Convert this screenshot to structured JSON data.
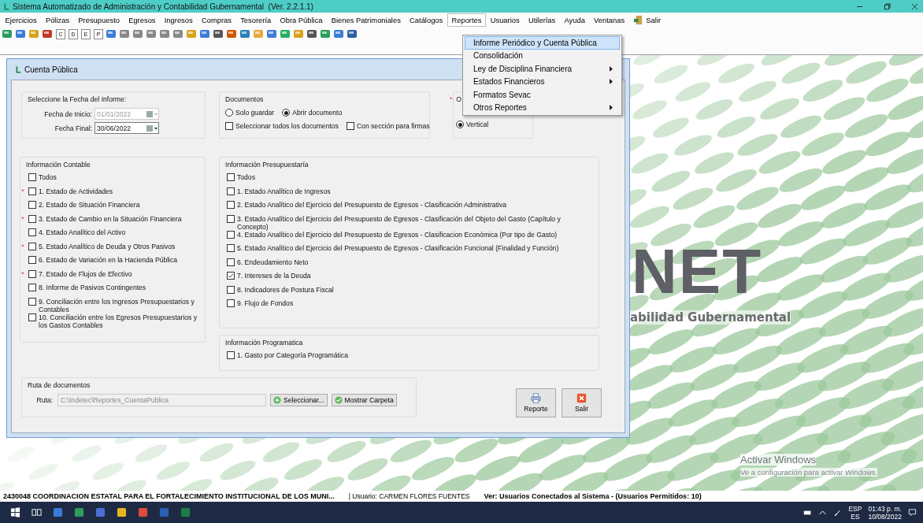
{
  "window": {
    "title": "Sistema Automatizado de Administración y Contabilidad Gubernamental  (Ver. 2.2.1.1)"
  },
  "menu": [
    {
      "label": "Ejercicios",
      "selected": false
    },
    {
      "label": "Pólizas",
      "selected": false
    },
    {
      "label": "Presupuesto",
      "selected": false
    },
    {
      "label": "Egresos",
      "selected": false
    },
    {
      "label": "Ingresos",
      "selected": false
    },
    {
      "label": "Compras",
      "selected": false
    },
    {
      "label": "Tesorería",
      "selected": false
    },
    {
      "label": "Obra Pública",
      "selected": false
    },
    {
      "label": "Bienes Patrimoniales",
      "selected": false
    },
    {
      "label": "Catálogos",
      "selected": false
    },
    {
      "label": "Reportes",
      "selected": true
    },
    {
      "label": "Usuarios",
      "selected": false
    },
    {
      "label": "Utilerías",
      "selected": false
    },
    {
      "label": "Ayuda",
      "selected": false
    },
    {
      "label": "Ventanas",
      "selected": false
    },
    {
      "label": "Salir",
      "selected": false,
      "kind": "exit"
    }
  ],
  "toolbar": {
    "letter_icons": [
      "C",
      "D",
      "E",
      "P"
    ]
  },
  "dropdown": [
    {
      "label": "Informe Periódico y Cuenta Pública",
      "selected": true,
      "submenu": false
    },
    {
      "label": "Consolidación",
      "selected": false,
      "submenu": false
    },
    {
      "label": "Ley de Disciplina Financiera",
      "selected": false,
      "submenu": true
    },
    {
      "label": "Estados Financieros",
      "selected": false,
      "submenu": true
    },
    {
      "label": "Formatos Sevac",
      "selected": false,
      "submenu": false
    },
    {
      "label": "Otros Reportes",
      "selected": false,
      "submenu": true
    }
  ],
  "dialog": {
    "title": "Cuenta Pública",
    "fecha": {
      "title": "Seleccione la Fecha del Informe:",
      "fields": [
        {
          "label": "Fecha de Inicio:",
          "value": "01/01/2022",
          "disabled": true
        },
        {
          "label": "Fecha Final:",
          "value": "30/06/2022",
          "disabled": false
        }
      ]
    },
    "documentos": {
      "title": "Documentos",
      "radios": [
        {
          "label": "Solo guardar",
          "selected": false
        },
        {
          "label": "Abrir documento",
          "selected": true
        }
      ],
      "checks": [
        {
          "label": "Seleccionar todos los documentos",
          "checked": false
        },
        {
          "label": "Con sección para firmas",
          "checked": false
        }
      ]
    },
    "orientacion": {
      "mark": "*",
      "title": "O",
      "radios": [
        {
          "label": "Vertical",
          "selected": true
        }
      ]
    },
    "contable": {
      "title": "Información Contable",
      "items": [
        {
          "label": "Todos",
          "checked": false
        },
        {
          "label": "1. Estado de Actividades",
          "checked": false,
          "mark": "*"
        },
        {
          "label": "2. Estado de Situación Financiera",
          "checked": false
        },
        {
          "label": "3. Estado de Cambio en la Situación Financiera",
          "checked": false,
          "mark": "*"
        },
        {
          "label": "4. Estado Analítico del Activo",
          "checked": false
        },
        {
          "label": "5. Estado Analítico de Deuda y Otros Pasivos",
          "checked": false,
          "mark": "*"
        },
        {
          "label": "6. Estado de Variación en la Hacienda Pública",
          "checked": false
        },
        {
          "label": "7. Estado de Flujos de Efectivo",
          "checked": false,
          "mark": "*"
        },
        {
          "label": "8. Informe de Pasivos Contingentes",
          "checked": false
        },
        {
          "label": "9. Conciliación entre los Ingresos Presupuestarios y Contables",
          "checked": false
        },
        {
          "label": "10. Conciliación entre los Egresos Presupuestarios y los Gastos Contables",
          "checked": false
        }
      ]
    },
    "presupuestaria": {
      "title": "Información Presupuestaría",
      "items": [
        {
          "label": "Todos",
          "checked": false
        },
        {
          "label": "1. Estado Analítico de Ingresos",
          "checked": false
        },
        {
          "label": "2. Estado Analítico del Ejercicio del Presupuesto de Egresos - Clasificación Administrativa",
          "checked": false
        },
        {
          "label": "3. Estado Analítico del Ejercicio del Presupuesto de Egresos - Clasificación del Objeto del Gasto (Capítulo y Concepto)",
          "checked": false
        },
        {
          "label": "4. Estado Analítico del Ejercicio del Presupuesto de Egresos - Clasificacion Económica (Por tipo de Gasto)",
          "checked": false
        },
        {
          "label": "5. Estado Analítico del Ejercicio del Presupuesto de Egresos - Clasificación Funcional (Finalidad y Función)",
          "checked": false
        },
        {
          "label": "6. Endeudamiento Neto",
          "checked": false
        },
        {
          "label": "7. Intereses de la Deuda",
          "checked": true
        },
        {
          "label": "8. Indicadores de Postura Fiscal",
          "checked": false
        },
        {
          "label": "9. Flujo de Fondos",
          "checked": false
        }
      ]
    },
    "programatica": {
      "title": "Información Programatica",
      "items": [
        {
          "label": "1. Gasto por Categoría Programática",
          "checked": false
        }
      ]
    },
    "ruta": {
      "title": "Ruta de documentos",
      "label": "Ruta:",
      "value": "C:\\Indetec\\Reportes_CuentaPublica",
      "buttons": [
        {
          "label": "Seleccionar...",
          "kind": "add"
        },
        {
          "label": "Mostrar Carpeta",
          "kind": "ok"
        }
      ]
    },
    "buttons": [
      {
        "label": "Reporte",
        "kind": "print"
      },
      {
        "label": "Salir",
        "kind": "close"
      }
    ]
  },
  "logo": {
    "text": "NET",
    "subtitle": "abilidad Gubernamental"
  },
  "activation": {
    "title": "Activar Windows",
    "text": "Ve a configuración para activar Windows."
  },
  "status_bar": {
    "organization": "2430048 COORDINACION ESTATAL PARA EL FORTALECIMIENTO INSTITUCIONAL DE LOS MUNI...",
    "user": "| Usuario: CARMEN FLORES FUENTES",
    "connected": "Ver: Usuarios Conectados al Sistema - (Usuarios Permitidos: 10)"
  },
  "taskbar": {
    "language": "ESP",
    "layout": "ES",
    "time": "01:43 p. m.",
    "date": "10/08/2022"
  }
}
